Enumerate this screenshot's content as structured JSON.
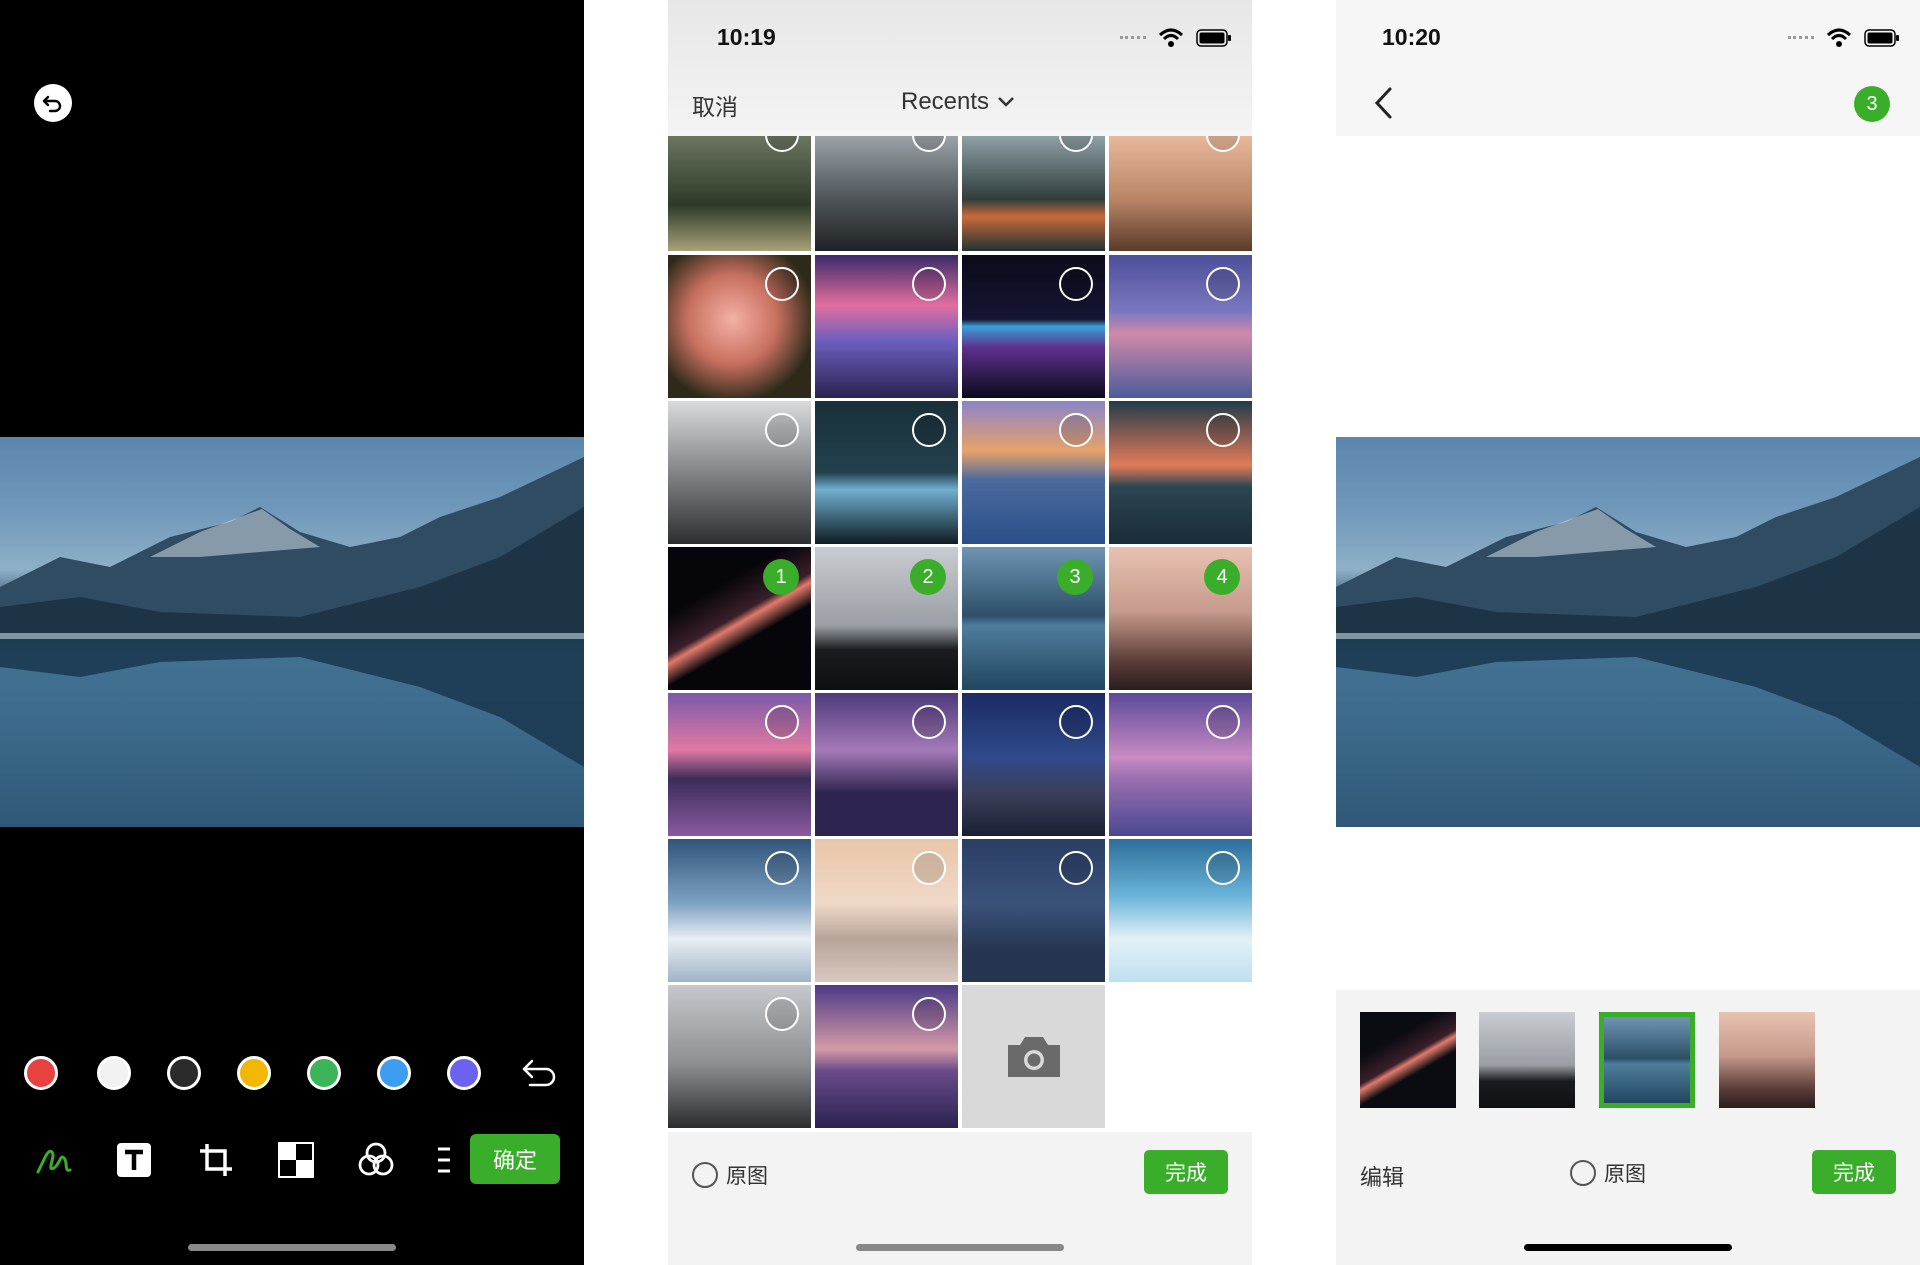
{
  "editor": {
    "colors": [
      "#e8413f",
      "#f2f2f2",
      "#2b2b2b",
      "#f2b705",
      "#3cb45a",
      "#3d9df0",
      "#6b63f0"
    ],
    "confirm_label": "确定",
    "accent": "#3aae2a"
  },
  "picker": {
    "time": "10:19",
    "cancel_label": "取消",
    "album_title": "Recents",
    "original_label": "原图",
    "done_label": "完成",
    "selection_numbers": [
      "1",
      "2",
      "3",
      "4"
    ]
  },
  "preview": {
    "time": "10:20",
    "selected_count": "3",
    "edit_label": "编辑",
    "original_label": "原图",
    "done_label": "完成"
  }
}
